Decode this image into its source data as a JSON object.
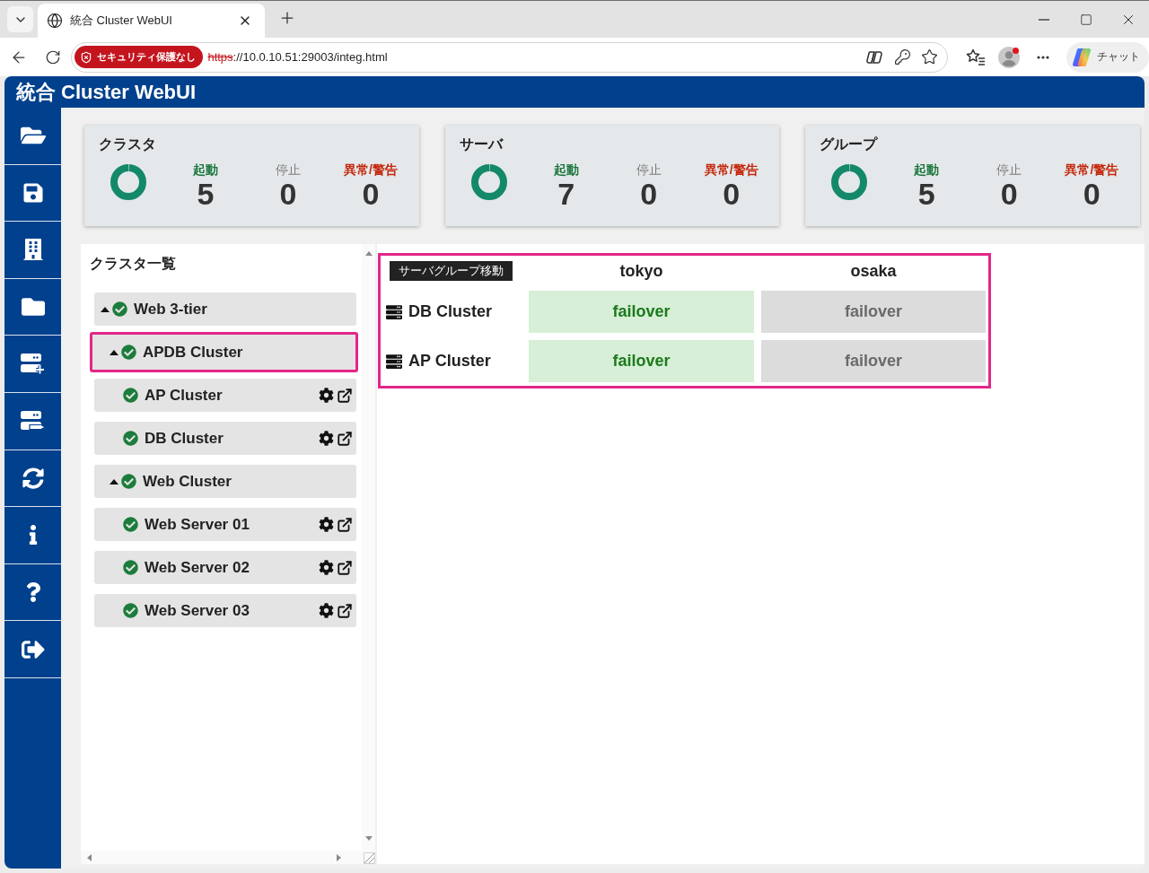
{
  "browser": {
    "tab_title": "統合 Cluster WebUI",
    "security_badge": "セキュリティ保護なし",
    "url_scheme": "https",
    "url_rest": "://10.0.10.51:29003/integ.html",
    "profile_notification": true,
    "chat_button": "チャット"
  },
  "app": {
    "title": "統合 Cluster WebUI"
  },
  "summary_cards": [
    {
      "title": "クラスタ",
      "stats": [
        {
          "kind": "running",
          "label": "起動",
          "value": "5"
        },
        {
          "kind": "stopped",
          "label": "停止",
          "value": "0"
        },
        {
          "kind": "error",
          "label": "異常/警告",
          "value": "0"
        }
      ]
    },
    {
      "title": "サーバ",
      "stats": [
        {
          "kind": "running",
          "label": "起動",
          "value": "7"
        },
        {
          "kind": "stopped",
          "label": "停止",
          "value": "0"
        },
        {
          "kind": "error",
          "label": "異常/警告",
          "value": "0"
        }
      ]
    },
    {
      "title": "グループ",
      "stats": [
        {
          "kind": "running",
          "label": "起動",
          "value": "5"
        },
        {
          "kind": "stopped",
          "label": "停止",
          "value": "0"
        },
        {
          "kind": "error",
          "label": "異常/警告",
          "value": "0"
        }
      ]
    }
  ],
  "cluster_list": {
    "title": "クラスタ一覧",
    "items": [
      {
        "name": "Web 3-tier",
        "expanded": true,
        "highlighted": false,
        "children": [
          {
            "name": "APDB Cluster",
            "expanded": true,
            "highlighted": true,
            "children": [
              {
                "name": "AP Cluster",
                "highlighted": false
              },
              {
                "name": "DB Cluster",
                "highlighted": false
              }
            ]
          },
          {
            "name": "Web Cluster",
            "expanded": true,
            "highlighted": false,
            "children": [
              {
                "name": "Web Server 01",
                "highlighted": false
              },
              {
                "name": "Web Server 02",
                "highlighted": false
              },
              {
                "name": "Web Server 03",
                "highlighted": false
              }
            ]
          }
        ]
      }
    ]
  },
  "server_group_table": {
    "highlighted": true,
    "badge": "サーバグループ移動",
    "columns": [
      "tokyo",
      "osaka"
    ],
    "rows": [
      {
        "name": "DB Cluster",
        "cells": [
          {
            "text": "failover",
            "active": true
          },
          {
            "text": "failover",
            "active": false
          }
        ]
      },
      {
        "name": "AP Cluster",
        "cells": [
          {
            "text": "failover",
            "active": true
          },
          {
            "text": "failover",
            "active": false
          }
        ]
      }
    ]
  }
}
